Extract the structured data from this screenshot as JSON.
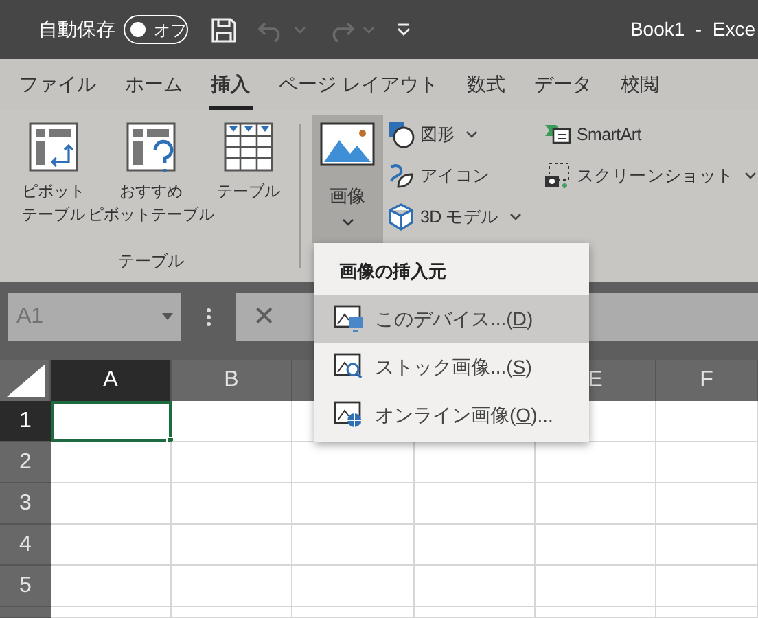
{
  "title_bar": {
    "autosave_label": "自動保存",
    "autosave": {
      "on": false,
      "label": "オフ"
    },
    "undo": {
      "disabled": true
    },
    "redo": {
      "disabled": true
    },
    "title": "Book1  -  Exce"
  },
  "tabs": [
    {
      "label": "ファイル",
      "selected": false
    },
    {
      "label": "ホーム",
      "selected": false
    },
    {
      "label": "挿入",
      "selected": true
    },
    {
      "label": "ページ レイアウト",
      "selected": false
    },
    {
      "label": "数式",
      "selected": false
    },
    {
      "label": "データ",
      "selected": false
    },
    {
      "label": "校閲",
      "selected": false
    }
  ],
  "ribbon": {
    "table_group": {
      "label": "テーブル",
      "buttons": [
        {
          "kind": "pivot",
          "lines": [
            "ピボット",
            "テーブル"
          ]
        },
        {
          "kind": "recommended",
          "lines": [
            "おすすめ",
            "ピボットテーブル"
          ]
        },
        {
          "kind": "table",
          "lines": [
            "テーブル"
          ]
        }
      ]
    },
    "picture_button": {
      "label": "画像",
      "selected": true
    },
    "small_columns": [
      [
        {
          "kind": "shapes",
          "label": "図形",
          "dropdown": true
        },
        {
          "kind": "icons",
          "label": "アイコン",
          "dropdown": false
        },
        {
          "kind": "model3d",
          "label": "3D モデル",
          "dropdown": true
        }
      ],
      [
        {
          "kind": "smartart",
          "label": "SmartArt",
          "dropdown": false
        },
        {
          "kind": "screenshot",
          "label": "スクリーンショット",
          "dropdown": true
        }
      ]
    ]
  },
  "formula_bar": {
    "name_box": "A1",
    "cancel": "✕"
  },
  "sheet": {
    "columns": [
      {
        "label": "A",
        "selected": true
      },
      {
        "label": "B",
        "selected": false
      },
      {},
      {},
      {
        "label": "E",
        "selected": false
      },
      {
        "label": "F",
        "selected": false
      }
    ],
    "rows": [
      {
        "label": "1",
        "selected": true
      },
      {
        "label": "2",
        "selected": false
      },
      {
        "label": "3",
        "selected": false
      },
      {
        "label": "4",
        "selected": false
      },
      {
        "label": "5",
        "selected": false
      }
    ]
  },
  "menu": {
    "title": "画像の挿入元",
    "items": [
      {
        "kind": "device",
        "before": "このデバイス...(",
        "key": "D",
        "after": ")",
        "selected": true
      },
      {
        "kind": "stock",
        "before": "ストック画像...(",
        "key": "S",
        "after": ")",
        "selected": false
      },
      {
        "kind": "online",
        "before": "オンライン画像(",
        "key": "O",
        "after": ")...",
        "selected": false
      }
    ]
  }
}
